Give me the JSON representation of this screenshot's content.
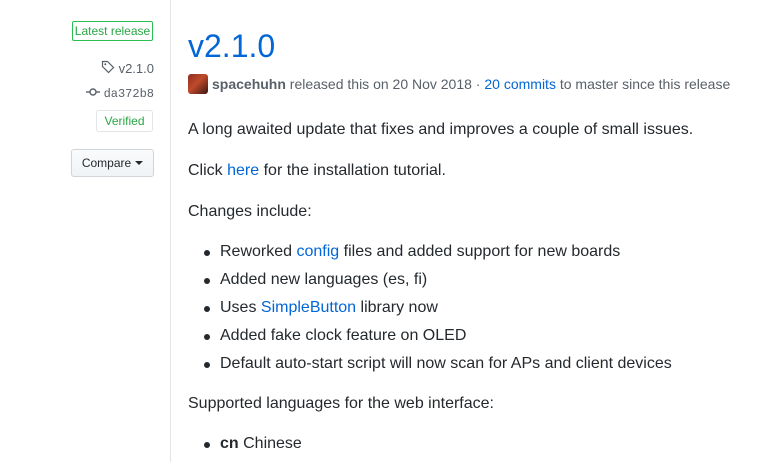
{
  "sidebar": {
    "latest_label": "Latest release",
    "tag": "v2.1.0",
    "commit": "da372b8",
    "verified": "Verified",
    "compare": "Compare"
  },
  "release": {
    "title": "v2.1.0",
    "author": "spacehuhn",
    "released_text": "released this on 20 Nov 2018 ·",
    "commits_link": "20 commits",
    "commits_suffix": "to master since this release",
    "intro": "A long awaited update that fixes and improves a couple of small issues.",
    "click_prefix": "Click",
    "click_link": "here",
    "click_suffix": "for the installation tutorial.",
    "changes_heading": "Changes include:",
    "changes": [
      {
        "pre": "Reworked",
        "link": "config",
        "post": "files and added support for new boards"
      },
      {
        "pre": "Added new languages (es, fi)",
        "link": "",
        "post": ""
      },
      {
        "pre": "Uses",
        "link": "SimpleButton",
        "post": "library now"
      },
      {
        "pre": "Added fake clock feature on OLED",
        "link": "",
        "post": ""
      },
      {
        "pre": "Default auto-start script will now scan for APs and client devices",
        "link": "",
        "post": ""
      }
    ],
    "languages_heading": "Supported languages for the web interface:",
    "languages": [
      {
        "code": "cn",
        "name": "Chinese"
      }
    ]
  },
  "icons": {
    "tag": "tag-icon",
    "commit": "git-commit-icon",
    "avatar": "avatar"
  },
  "colors": {
    "link": "#0366d6",
    "green": "#28a745",
    "text": "#24292e",
    "muted": "#586069"
  }
}
